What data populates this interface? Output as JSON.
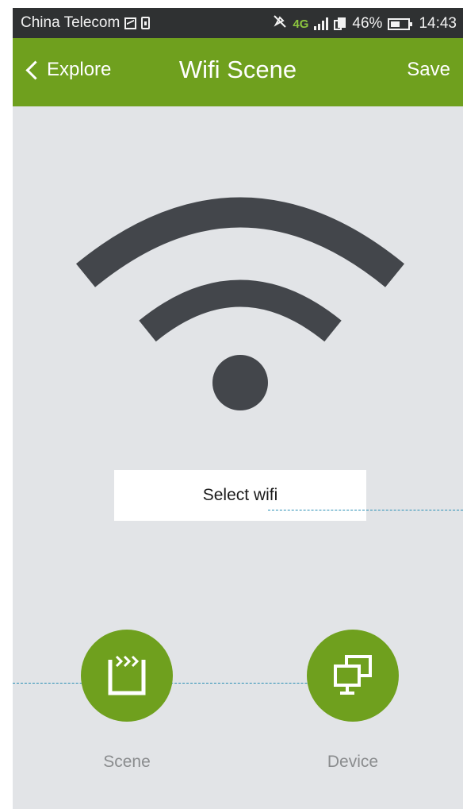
{
  "status_bar": {
    "carrier": "China Telecom",
    "network": "4G",
    "battery": "46%",
    "time": "14:43",
    "icons": [
      "image-icon",
      "sim-icon",
      "mute-icon",
      "4g-icon",
      "signal-icon",
      "copy-icon",
      "battery-icon"
    ]
  },
  "nav": {
    "back_label": "Explore",
    "title": "Wifi Scene",
    "save_label": "Save"
  },
  "main": {
    "illustration_icon": "wifi-icon",
    "select_wifi_label": "Select wifi"
  },
  "actions": [
    {
      "label": "Scene",
      "icon": "clapperboard-icon"
    },
    {
      "label": "Device",
      "icon": "monitors-icon"
    }
  ],
  "colors": {
    "accent": "#6fa01e",
    "status_bar": "#2f3132",
    "background": "#e2e4e7",
    "wifi_graphic": "#43464b",
    "label_gray": "#8a8c8e"
  }
}
